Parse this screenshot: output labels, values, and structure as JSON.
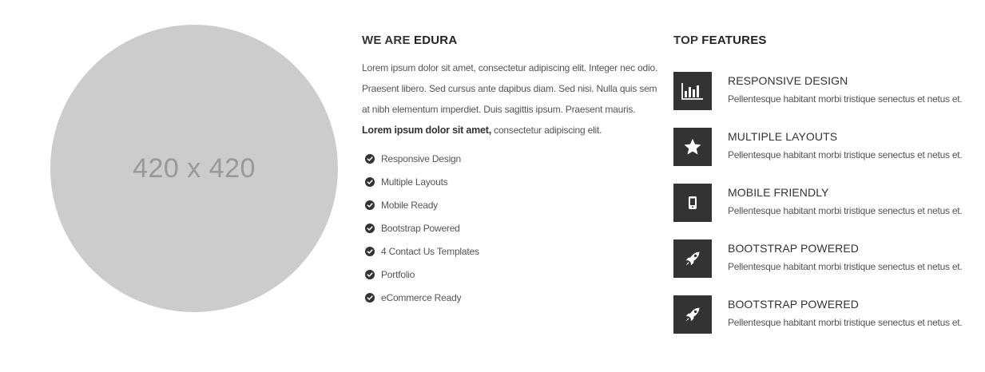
{
  "placeholder": {
    "label": "420 x 420"
  },
  "about": {
    "heading_prefix": "WE ARE",
    "heading_bold": "EDURA",
    "paragraph_part1": "Lorem ipsum dolor sit amet, consectetur adipiscing elit. Integer nec odio. Praesent libero. Sed cursus ante dapibus diam. Sed nisi. Nulla quis sem at nibh elementum imperdiet. Duis sagittis ipsum. Praesent mauris.",
    "paragraph_bold": "Lorem ipsum dolor sit amet,",
    "paragraph_part2": "consectetur adipiscing elit.",
    "checklist": [
      {
        "label": "Responsive Design",
        "icon": "check-circle-icon"
      },
      {
        "label": "Multiple Layouts",
        "icon": "check-circle-icon"
      },
      {
        "label": "Mobile Ready",
        "icon": "check-circle-icon"
      },
      {
        "label": "Bootstrap Powered",
        "icon": "check-circle-icon"
      },
      {
        "label": "4 Contact Us Templates",
        "icon": "check-circle-icon"
      },
      {
        "label": "Portfolio",
        "icon": "check-circle-icon"
      },
      {
        "label": "eCommerce Ready",
        "icon": "check-circle-icon"
      }
    ]
  },
  "features": {
    "heading_prefix": "TOP",
    "heading_bold": "FEATURES",
    "items": [
      {
        "title": "RESPONSIVE DESIGN",
        "desc": "Pellentesque habitant morbi tristique senectus et netus et.",
        "icon": "bar-chart-icon"
      },
      {
        "title": "MULTIPLE LAYOUTS",
        "desc": "Pellentesque habitant morbi tristique senectus et netus et.",
        "icon": "star-icon"
      },
      {
        "title": "MOBILE FRIENDLY",
        "desc": "Pellentesque habitant morbi tristique senectus et netus et.",
        "icon": "mobile-phone-icon"
      },
      {
        "title": "BOOTSTRAP POWERED",
        "desc": "Pellentesque habitant morbi tristique senectus et netus et.",
        "icon": "rocket-icon"
      },
      {
        "title": "BOOTSTRAP POWERED",
        "desc": "Pellentesque habitant morbi tristique senectus et netus et.",
        "icon": "rocket-icon"
      }
    ]
  },
  "colors": {
    "icon_background": "#333333",
    "placeholder_fill": "#cccccc",
    "placeholder_text": "#999999",
    "body_text": "#555555"
  }
}
